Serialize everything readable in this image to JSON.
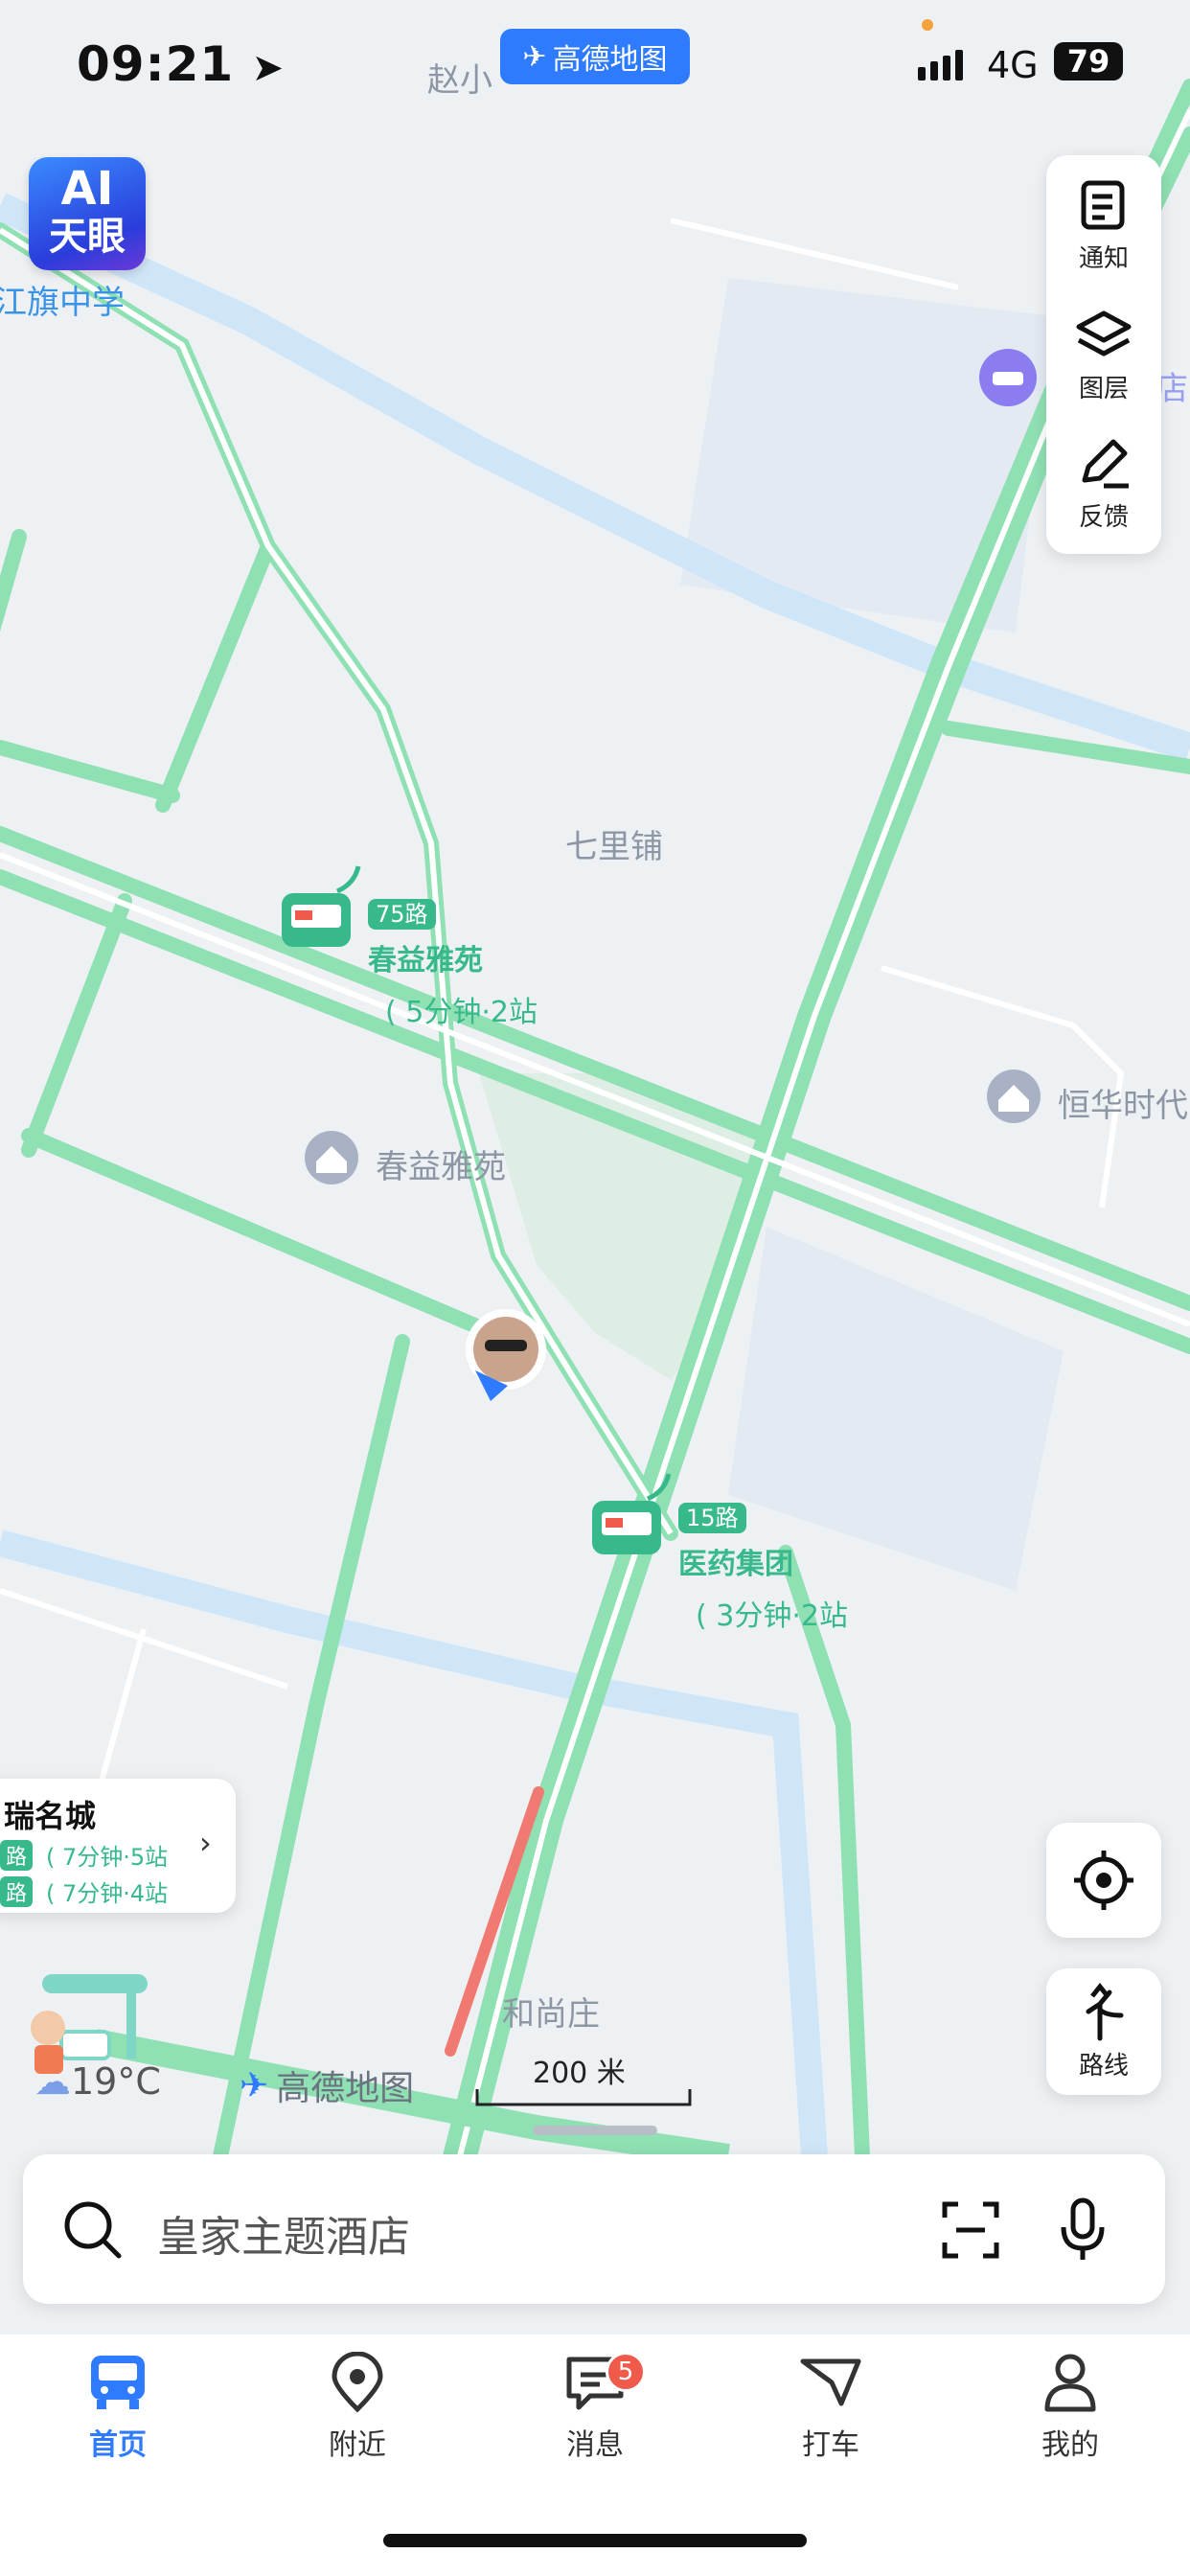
{
  "status_bar": {
    "time": "09:21",
    "network": "4G",
    "battery": "79"
  },
  "app_badge": {
    "label": "高德地图"
  },
  "ai_button": {
    "line1": "AI",
    "line2": "天眼"
  },
  "map": {
    "place_labels": {
      "top_left": "江旗中学",
      "top_center": "赵小",
      "qilipu": "七里铺",
      "chunyi": "春益雅苑",
      "henghua": "恒华时代",
      "heshangzhuang": "和尚庄",
      "right_edge": "店"
    },
    "bus_stops": [
      {
        "route": "75路",
        "name": "春益雅苑",
        "eta": "5分钟·2站"
      },
      {
        "route": "15路",
        "name": "医药集团",
        "eta": "3分钟·2站"
      }
    ],
    "scale": "200 米",
    "brand": "高德地图",
    "weather": "19°C"
  },
  "right_panel": {
    "items": [
      {
        "label": "通知",
        "icon": "notice-icon"
      },
      {
        "label": "图层",
        "icon": "layers-icon"
      },
      {
        "label": "反馈",
        "icon": "feedback-icon"
      }
    ],
    "route_label": "路线"
  },
  "nearby_card": {
    "title": "瑞名城",
    "rows": [
      {
        "route": "路",
        "eta": "7分钟·5站"
      },
      {
        "route": "路",
        "eta": "7分钟·4站"
      }
    ]
  },
  "search": {
    "placeholder": "皇家主题酒店"
  },
  "tabs": [
    {
      "label": "首页",
      "icon": "bus-icon",
      "active": true
    },
    {
      "label": "附近",
      "icon": "location-pin-icon"
    },
    {
      "label": "消息",
      "icon": "message-icon",
      "badge": "5"
    },
    {
      "label": "打车",
      "icon": "taxi-icon"
    },
    {
      "label": "我的",
      "icon": "profile-icon"
    }
  ],
  "colors": {
    "road": "#8fe0b3",
    "accent": "#2f7bff",
    "bus": "#38b98b",
    "traffic_jam": "#f07a72",
    "water": "#cfe6f8"
  }
}
